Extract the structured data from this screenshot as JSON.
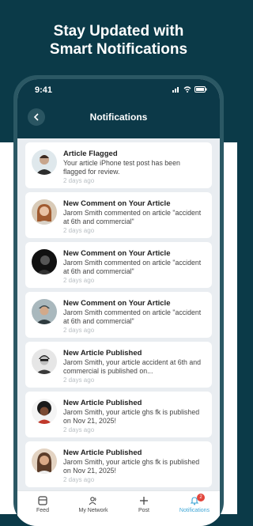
{
  "headline": [
    "Stay Updated with",
    "Smart Notifications"
  ],
  "status": {
    "time": "9:41"
  },
  "header": {
    "title": "Notifications"
  },
  "notifications": [
    {
      "title": "Article Flagged",
      "body": "Your article iPhone test post has been flagged for review.",
      "time": "2 days ago",
      "avatar": "#8aa7b4"
    },
    {
      "title": "New Comment on Your Article",
      "body": "Jarom Smith commented on article \"accident at 6th and commercial\"",
      "time": "2 days ago",
      "avatar": "#c38a63"
    },
    {
      "title": "New Comment on Your Article",
      "body": "Jarom Smith commented on article \"accident at 6th and commercial\"",
      "time": "2 days ago",
      "avatar": "#1e1e1e"
    },
    {
      "title": "New Comment on Your Article",
      "body": "Jarom Smith commented on article \"accident at 6th and commercial\"",
      "time": "2 days ago",
      "avatar": "#7a8f96"
    },
    {
      "title": "New Article Published",
      "body": "Jarom Smith, your article accident at 6th and commercial is published on...",
      "time": "2 days ago",
      "avatar": "#cfcfcf"
    },
    {
      "title": "New Article Published",
      "body": "Jarom Smith, your article ghs fk is published on Nov 21, 2025!",
      "time": "2 days ago",
      "avatar": "#b03a3a"
    },
    {
      "title": "New Article Published",
      "body": "Jarom Smith, your article ghs fk is published on Nov 21, 2025!",
      "time": "2 days ago",
      "avatar": "#a0714f"
    }
  ],
  "tabs": [
    {
      "label": "Feed",
      "icon": "feed-icon"
    },
    {
      "label": "My Network",
      "icon": "network-icon"
    },
    {
      "label": "Post",
      "icon": "plus-icon"
    },
    {
      "label": "Notifications",
      "icon": "bell-icon",
      "badge": "2"
    }
  ],
  "colors": {
    "brand_dark": "#0c3948",
    "accent": "#3ea6d6",
    "badge": "#e2453b"
  }
}
